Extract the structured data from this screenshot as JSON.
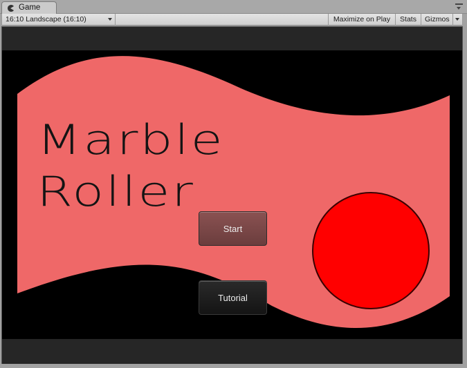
{
  "tab": {
    "label": "Game",
    "icon": "pacman-icon"
  },
  "toolbar": {
    "aspect_selected": "16:10 Landscape (16:10)",
    "maximize_label": "Maximize on Play",
    "stats_label": "Stats",
    "gizmos_label": "Gizmos"
  },
  "game": {
    "title_line1": "Marble",
    "title_line2": "Roller",
    "start_label": "Start",
    "tutorial_label": "Tutorial",
    "colors": {
      "banner": "#ef6868",
      "marble": "#ff0000",
      "background": "#000000"
    }
  }
}
